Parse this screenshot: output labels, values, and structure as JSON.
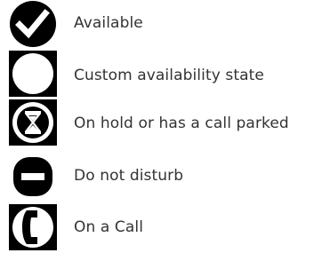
{
  "legend": {
    "items": [
      {
        "icon": "available-checkmark-icon",
        "label": "Available"
      },
      {
        "icon": "custom-availability-circle-icon",
        "label": "Custom availability state"
      },
      {
        "icon": "hourglass-icon",
        "label": "On hold or has a call parked"
      },
      {
        "icon": "do-not-disturb-icon",
        "label": "Do not disturb"
      },
      {
        "icon": "phone-handset-icon",
        "label": "On a Call"
      }
    ]
  }
}
